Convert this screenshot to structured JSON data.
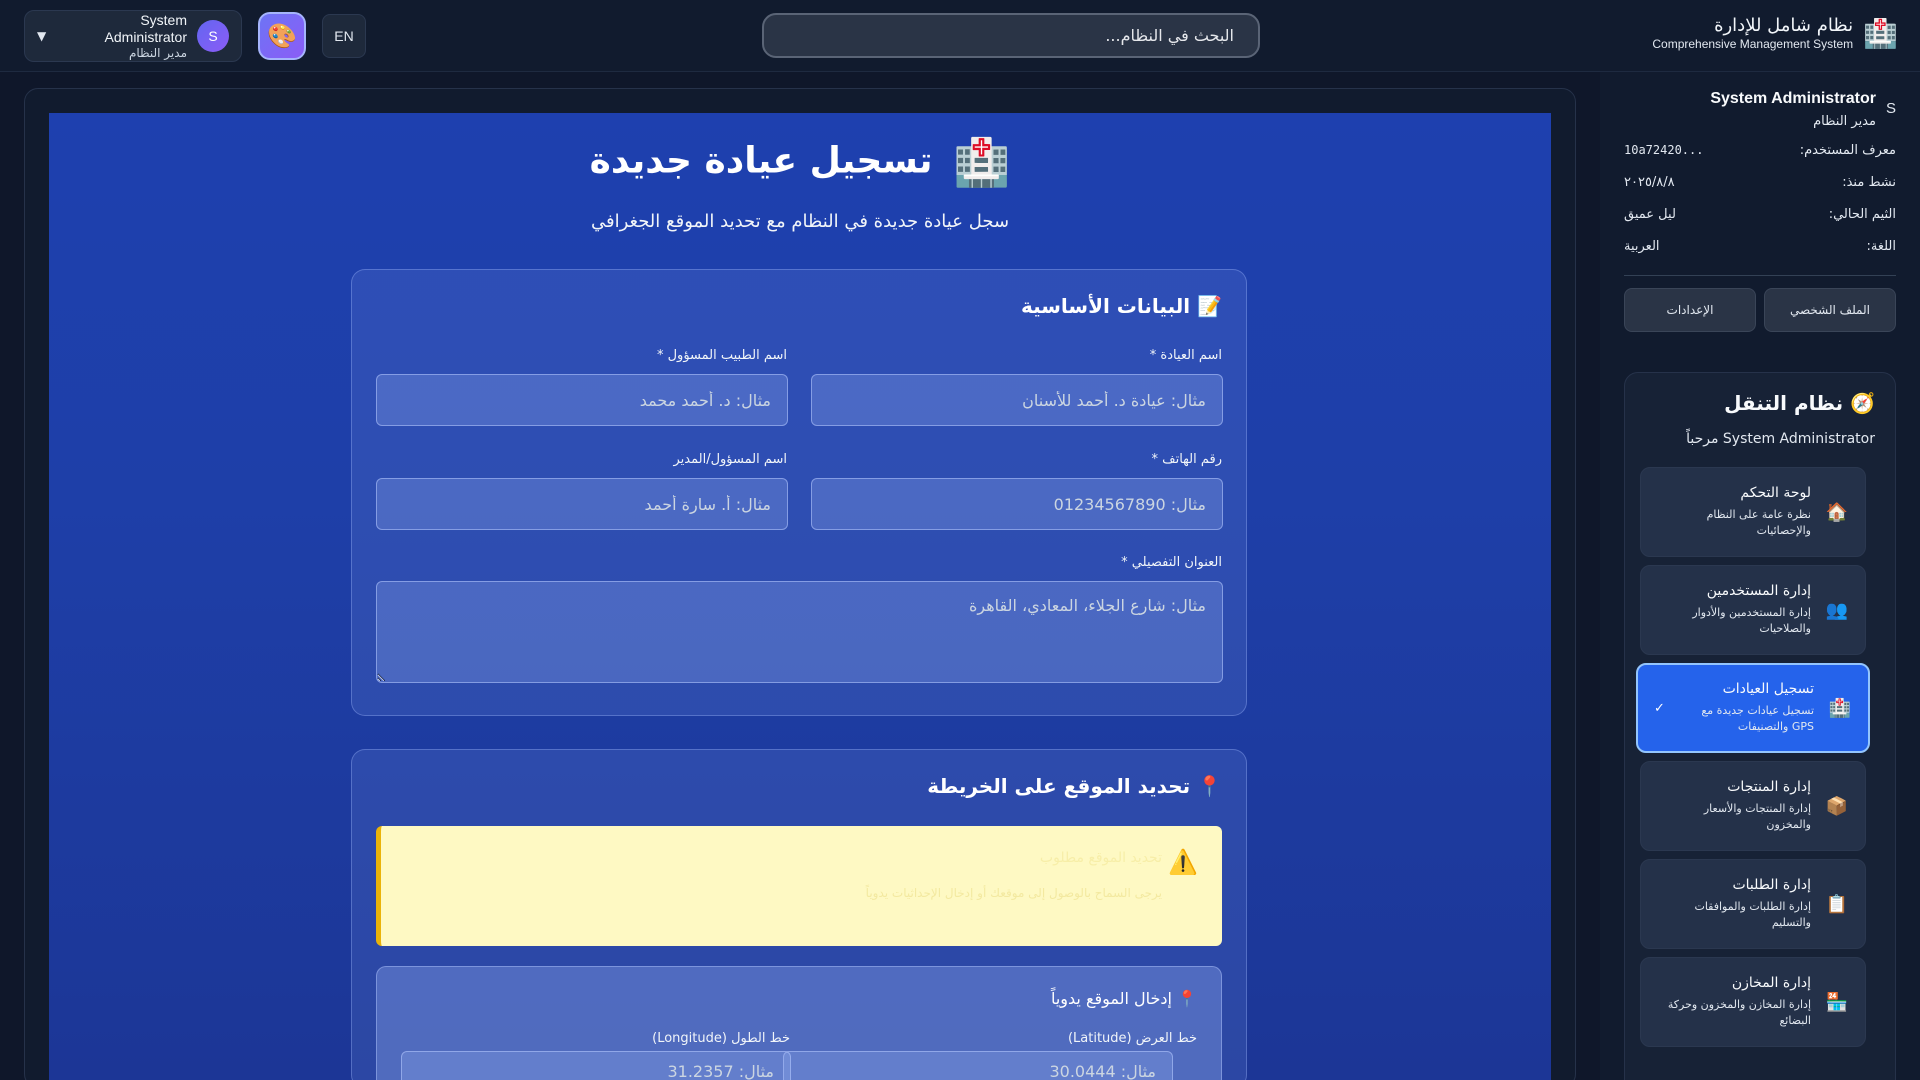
{
  "header": {
    "user_name": "System Administrator",
    "user_role": "مدير النظام",
    "avatar_letter": "S",
    "lang_label": "EN",
    "search_placeholder": "البحث في النظام...",
    "brand_title": "نظام شامل للإدارة",
    "brand_subtitle": "Comprehensive Management System",
    "caret": "▼",
    "theme_icon": "🎨",
    "brand_icon": "🏥"
  },
  "sidebar": {
    "profile": {
      "name": "System Administrator",
      "role": "مدير النظام",
      "letter": "S",
      "rows": [
        {
          "label": "معرف المستخدم:",
          "value": "...10a72420"
        },
        {
          "label": "نشط منذ:",
          "value": "٢٠٢٥/٨/٨"
        },
        {
          "label": "الثيم الحالي:",
          "value": "ليل عميق"
        },
        {
          "label": "اللغة:",
          "value": "العربية"
        }
      ],
      "btn_profile": "الملف الشخصي",
      "btn_settings": "الإعدادات"
    },
    "nav": {
      "title": "نظام التنقل",
      "title_icon": "🧭",
      "welcome": "مرحباً System Administrator",
      "items": [
        {
          "icon": "🏠",
          "label": "لوحة التحكم",
          "desc": "نظرة عامة على النظام والإحصائيات"
        },
        {
          "icon": "👥",
          "label": "إدارة المستخدمين",
          "desc": "إدارة المستخدمين والأدوار والصلاحيات"
        },
        {
          "icon": "🏥",
          "label": "تسجيل العيادات",
          "desc": "تسجيل عيادات جديدة مع GPS والتصنيفات",
          "active_mark": "✓"
        },
        {
          "icon": "📦",
          "label": "إدارة المنتجات",
          "desc": "إدارة المنتجات والأسعار والمخزون"
        },
        {
          "icon": "📋",
          "label": "إدارة الطلبات",
          "desc": "إدارة الطلبات والموافقات والتسليم"
        },
        {
          "icon": "🏪",
          "label": "إدارة المخازن",
          "desc": "إدارة المخازن والمخزون وحركة البضائع"
        }
      ]
    }
  },
  "main": {
    "title": "تسجيل عيادة جديدة",
    "title_icon": "🏥",
    "subtitle": "سجل عيادة جديدة في النظام مع تحديد الموقع الجغرافي",
    "basic": {
      "title": "📝 البيانات الأساسية",
      "clinic_name_label": "اسم العيادة *",
      "clinic_name_placeholder": "مثال: عيادة د. أحمد للأسنان",
      "doctor_label": "اسم الطبيب المسؤول *",
      "doctor_placeholder": "مثال: د. أحمد محمد",
      "phone_label": "رقم الهاتف *",
      "phone_placeholder": "مثال: 01234567890",
      "manager_label": "اسم المسؤول/المدير",
      "manager_placeholder": "مثال: أ. سارة أحمد",
      "address_label": "العنوان التفصيلي *",
      "address_placeholder": "مثال: شارع الجلاء، المعادي، القاهرة"
    },
    "map": {
      "title": "📍 تحديد الموقع على الخريطة",
      "warn_icon": "⚠️",
      "warn_title": "تحديد الموقع مطلوب",
      "warn_desc": "يرجى السماح بالوصول إلى موقعك أو إدخال الإحداثيات يدوياً",
      "manual_title": "📍 إدخال الموقع يدوياً",
      "lat_label": "خط العرض (Latitude)",
      "lat_placeholder": "مثال: 30.0444",
      "lng_label": "خط الطول (Longitude)",
      "lng_placeholder": "مثال: 31.2357"
    }
  }
}
